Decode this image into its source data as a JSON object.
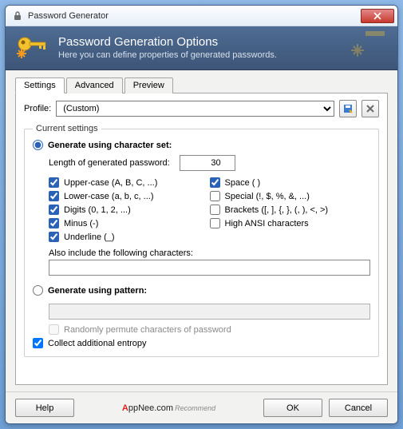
{
  "window": {
    "title": "Password Generator"
  },
  "banner": {
    "heading": "Password Generation Options",
    "subheading": "Here you can define properties of generated passwords."
  },
  "tabs": {
    "settings": "Settings",
    "advanced": "Advanced",
    "preview": "Preview"
  },
  "profile": {
    "label": "Profile:",
    "value": "(Custom)"
  },
  "group_legend": "Current settings",
  "charset": {
    "radio_label": "Generate using character set:",
    "length_label": "Length of generated password:",
    "length_value": "30",
    "options": {
      "upper": {
        "label": "Upper-case (A, B, C, ...)",
        "checked": true
      },
      "space": {
        "label": "Space ( )",
        "checked": true
      },
      "lower": {
        "label": "Lower-case (a, b, c, ...)",
        "checked": true
      },
      "special": {
        "label": "Special (!, $, %, &, ...)",
        "checked": false
      },
      "digits": {
        "label": "Digits (0, 1, 2, ...)",
        "checked": true
      },
      "brackets": {
        "label": "Brackets ([, ], {, }, (, ), <, >)",
        "checked": false
      },
      "minus": {
        "label": "Minus (-)",
        "checked": true
      },
      "highansi": {
        "label": "High ANSI characters",
        "checked": false
      },
      "underline": {
        "label": "Underline (_)",
        "checked": true
      }
    },
    "also_label": "Also include the following characters:",
    "also_value": ""
  },
  "pattern": {
    "radio_label": "Generate using pattern:",
    "value": "",
    "permute_label": "Randomly permute characters of password"
  },
  "entropy_label": "Collect additional entropy",
  "buttons": {
    "help": "Help",
    "ok": "OK",
    "cancel": "Cancel"
  },
  "watermark": {
    "brand": "ppNee",
    "prefix": "A",
    "suffix": ".com",
    "tag": "Recommend"
  }
}
